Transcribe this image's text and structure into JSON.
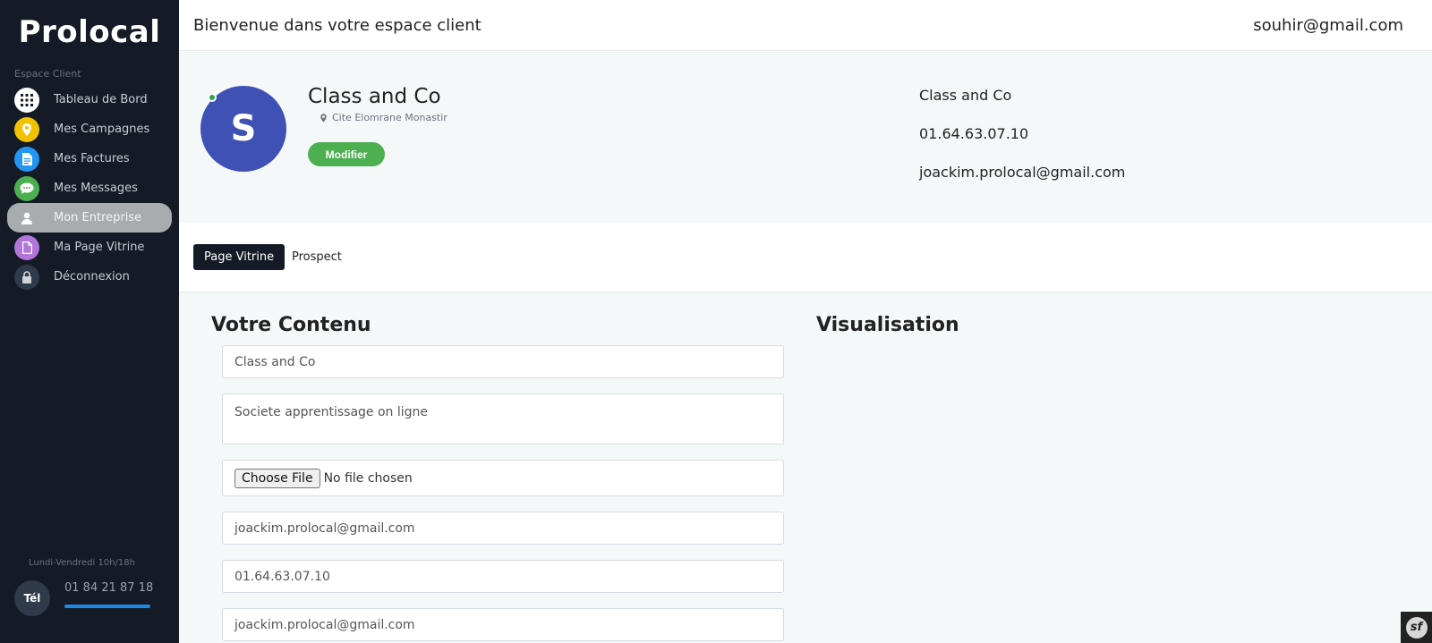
{
  "sidebar": {
    "brand": "Prolocal",
    "section_label": "Espace Client",
    "items": [
      {
        "label": "Tableau de Bord",
        "icon": "grid-icon",
        "color": "#ffffff"
      },
      {
        "label": "Mes Campagnes",
        "icon": "map-pin-icon",
        "color": "#f2c200"
      },
      {
        "label": "Mes Factures",
        "icon": "document-icon",
        "color": "#2196f3"
      },
      {
        "label": "Mes Messages",
        "icon": "chat-icon",
        "color": "#4caf50"
      },
      {
        "label": "Mon Entreprise",
        "icon": "user-icon",
        "color": "#a8acae"
      },
      {
        "label": "Ma Page Vitrine",
        "icon": "page-icon",
        "color": "#b275d8"
      },
      {
        "label": "Déconnexion",
        "icon": "lock-icon",
        "color": "#2f3a4a"
      }
    ],
    "active_item": "Mon Entreprise",
    "hours": "Lundi-Vendredi 10h/18h",
    "tel_badge": "Tél",
    "phone": "01 84 21 87 18"
  },
  "topbar": {
    "welcome": "Bienvenue dans votre espace client",
    "user_email": "souhir@gmail.com"
  },
  "profile": {
    "avatar_letter": "S",
    "company_name": "Class and Co",
    "location": "Cite Elomrane Monastir",
    "modify_label": "Modifier",
    "contact_name": "Class and Co",
    "contact_phone": "01.64.63.07.10",
    "contact_email": "joackim.prolocal@gmail.com"
  },
  "tabs": [
    {
      "label": "Page Vitrine",
      "active": true
    },
    {
      "label": "Prospect",
      "active": false
    }
  ],
  "content": {
    "title": "Votre Contenu",
    "preview_title": "Visualisation",
    "fields": {
      "name": "Class and Co",
      "description": "Societe apprentissage on ligne",
      "file_button": "Choose File",
      "file_status": "No file chosen",
      "email": "joackim.prolocal@gmail.com",
      "phone": "01.64.63.07.10",
      "email2": "joackim.prolocal@gmail.com"
    }
  },
  "colors": {
    "sidebar_bg": "#141b26",
    "avatar": "#3f51b5",
    "modify_button": "#4caf50",
    "online": "#2ea44f",
    "active_tab": "#141b26"
  }
}
